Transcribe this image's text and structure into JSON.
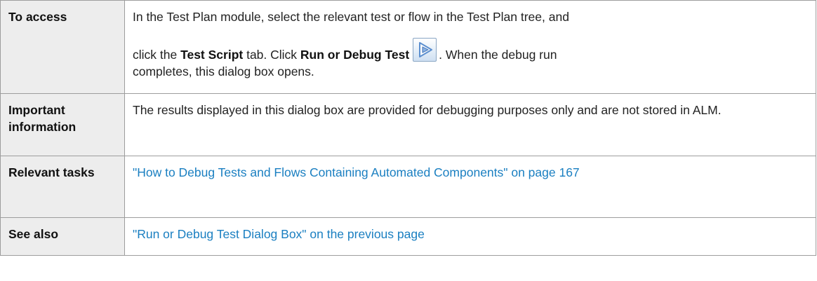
{
  "rows": {
    "access": {
      "label": "To access",
      "line1": "In the Test Plan module, select the relevant test or flow in the Test Plan tree, and",
      "part1": "click the ",
      "bold1": "Test Script",
      "part2": " tab. Click ",
      "bold2": "Run or Debug Test",
      "icon": "run-or-debug-test-icon",
      "part3": ". When the debug run",
      "line3": "completes, this dialog box opens."
    },
    "important": {
      "label": "Important information",
      "text": "The results displayed in this dialog box are provided for debugging purposes only and are not stored in ALM."
    },
    "tasks": {
      "label": "Relevant tasks",
      "link": "\"How to Debug Tests and Flows Containing Automated Components\" on page 167"
    },
    "see_also": {
      "label": "See also",
      "link": "\"Run or Debug Test Dialog Box\" on the previous page"
    }
  },
  "colors": {
    "link": "#1a7fc1",
    "label_background": "#ededed",
    "border": "#9d9d9d"
  }
}
